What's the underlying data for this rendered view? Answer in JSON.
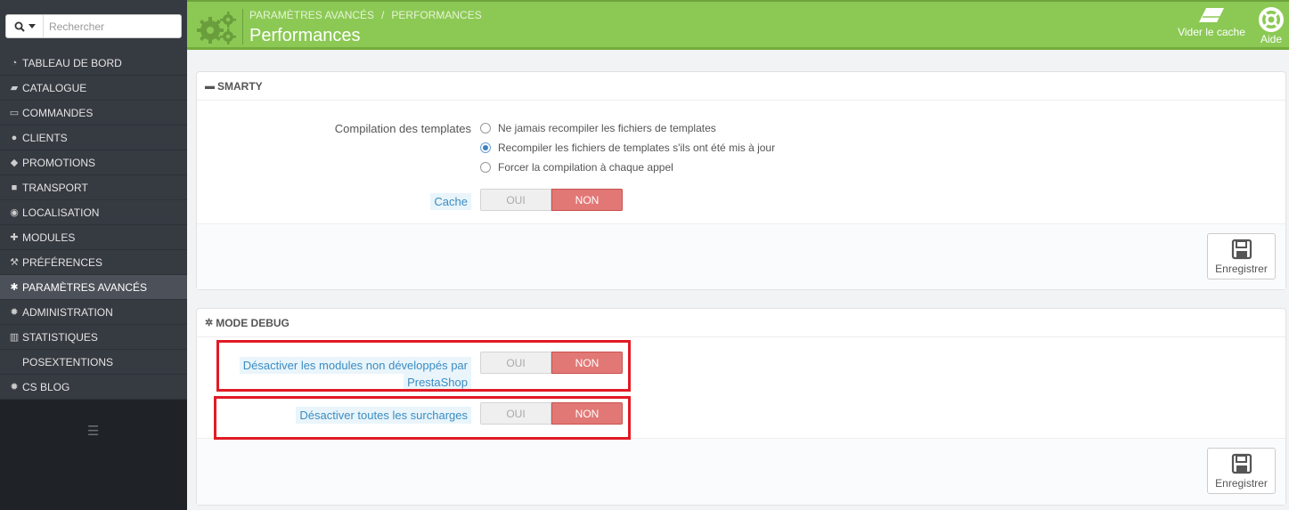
{
  "search": {
    "placeholder": "Rechercher"
  },
  "sidebar": {
    "items": [
      {
        "label": "TABLEAU DE BORD",
        "icon": "dashboard-icon",
        "active": false
      },
      {
        "label": "CATALOGUE",
        "icon": "book-icon",
        "active": false
      },
      {
        "label": "COMMANDES",
        "icon": "credit-card-icon",
        "active": false
      },
      {
        "label": "CLIENTS",
        "icon": "users-icon",
        "active": false
      },
      {
        "label": "PROMOTIONS",
        "icon": "tags-icon",
        "active": false
      },
      {
        "label": "TRANSPORT",
        "icon": "truck-icon",
        "active": false
      },
      {
        "label": "LOCALISATION",
        "icon": "globe-icon",
        "active": false
      },
      {
        "label": "MODULES",
        "icon": "puzzle-icon",
        "active": false
      },
      {
        "label": "PRÉFÉRENCES",
        "icon": "wrench-icon",
        "active": false
      },
      {
        "label": "PARAMÈTRES AVANCÉS",
        "icon": "cogs-icon",
        "active": true
      },
      {
        "label": "ADMINISTRATION",
        "icon": "cog-icon",
        "active": false
      },
      {
        "label": "STATISTIQUES",
        "icon": "bar-chart-icon",
        "active": false
      },
      {
        "label": "POSEXTENTIONS",
        "icon": "",
        "active": false
      },
      {
        "label": "CS BLOG",
        "icon": "cog-icon",
        "active": false
      }
    ]
  },
  "header": {
    "breadcrumb": [
      "PARAMÈTRES AVANCÉS",
      "/",
      "PERFORMANCES"
    ],
    "title": "Performances",
    "tools": {
      "clear_cache": "Vider le cache",
      "help": "Aide"
    },
    "color": "#8bc954"
  },
  "smarty": {
    "heading": "SMARTY",
    "compilation_label": "Compilation des templates",
    "options": [
      "Ne jamais recompiler les fichiers de templates",
      "Recompiler les fichiers de templates s'ils ont été mis à jour",
      "Forcer la compilation à chaque appel"
    ],
    "selected_option": 1,
    "cache_label": "Cache",
    "cache_yes": "OUI",
    "cache_no": "NON",
    "save": "Enregistrer"
  },
  "debug": {
    "heading": "MODE DEBUG",
    "modules_label_line1": "Désactiver les modules non développés par",
    "modules_label_line2": "PrestaShop",
    "modules_yes": "OUI",
    "modules_no": "NON",
    "overrides_label": "Désactiver toutes les surcharges",
    "overrides_yes": "OUI",
    "overrides_no": "NON",
    "save": "Enregistrer"
  },
  "colors": {
    "highlight_box": "#e01b24",
    "switch_off": "#e17875"
  }
}
